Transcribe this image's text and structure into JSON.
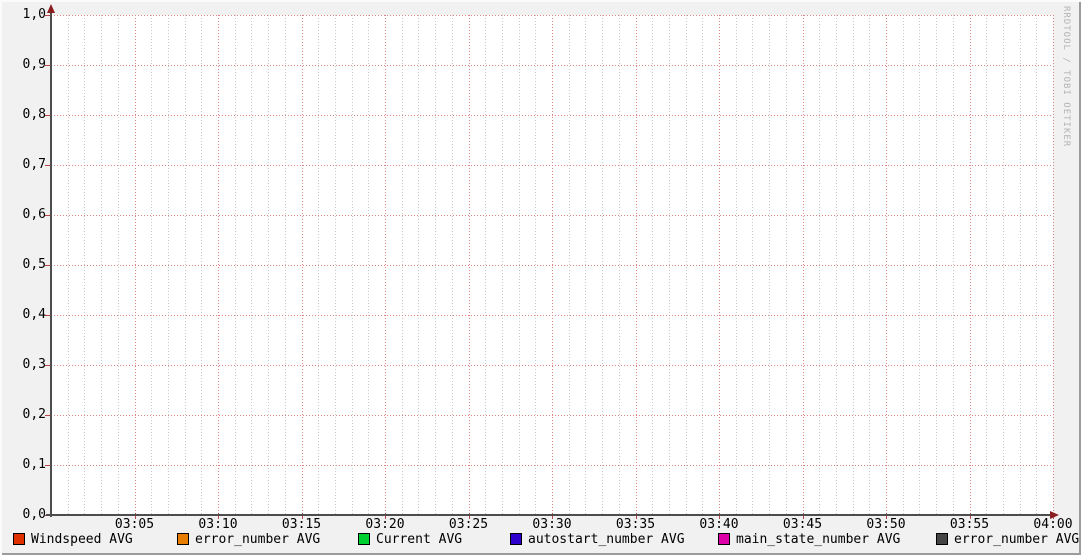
{
  "watermark": "RRDTOOL / TOBI OETIKER",
  "colors": {
    "background": "#f1f1f1",
    "plot_background": "#ffffff",
    "axis": "#4d4d4d",
    "arrow": "#8b1f1f",
    "major_grid": "#dc8484",
    "minor_grid": "#c9c9c9"
  },
  "chart_data": {
    "type": "line",
    "title": "",
    "xlabel": "",
    "ylabel": "",
    "x_axis": {
      "range": [
        "03:00",
        "04:00"
      ],
      "tick_labels": [
        "03:05",
        "03:10",
        "03:15",
        "03:20",
        "03:25",
        "03:30",
        "03:35",
        "03:40",
        "03:45",
        "03:50",
        "03:55",
        "04:00"
      ],
      "minor_per_major": 5
    },
    "y_axis": {
      "ylim": [
        0.0,
        1.0
      ],
      "major_step": 0.1,
      "tick_labels_top_to_bottom": [
        "1,0",
        "0,9",
        "0,8",
        "0,7",
        "0,6",
        "0,5",
        "0,4",
        "0,3",
        "0,2",
        "0,1",
        "0,0"
      ]
    },
    "grid": true,
    "legend_position": "bottom",
    "series": [
      {
        "name": "Windspeed AVG",
        "color": "#e03000",
        "values": []
      },
      {
        "name": "error_number AVG",
        "color": "#e87e00",
        "values": []
      },
      {
        "name": "Current AVG",
        "color": "#00d030",
        "values": []
      },
      {
        "name": "autostart_number AVG",
        "color": "#2e00cc",
        "values": []
      },
      {
        "name": "main_state_number AVG",
        "color": "#dd00a8",
        "values": []
      },
      {
        "name": "error_number AVG",
        "color": "#444444",
        "values": []
      }
    ]
  }
}
